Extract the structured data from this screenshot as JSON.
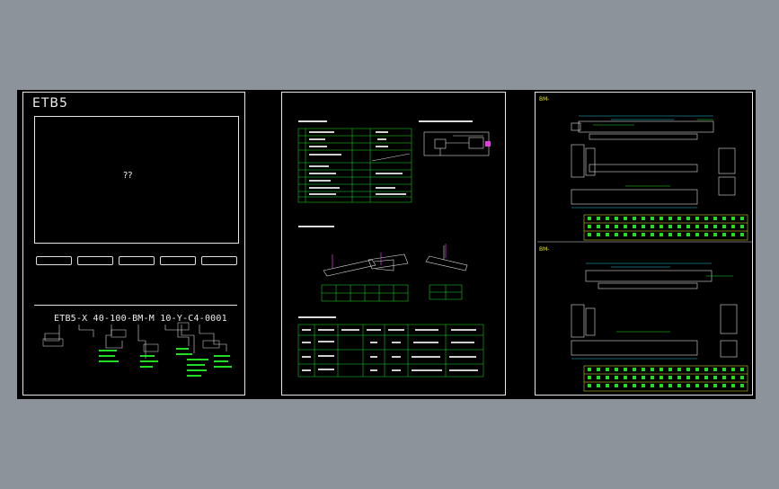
{
  "sheet1": {
    "title": "ETB5",
    "preview_text": "??",
    "buttons": [
      "",
      "",
      "",
      "",
      ""
    ],
    "model_label": "",
    "model_code": "ETB5-X 40-100-BM-M 10-Y-C4-0001"
  },
  "sheet2": {
    "section_titles": [
      "",
      "",
      "",
      ""
    ]
  },
  "sheet3": {
    "titles": [
      "BM-",
      "BM-"
    ]
  },
  "colors": {
    "background": "#8d939b",
    "canvas": "#000000",
    "frame": "#e6e6e6",
    "green": "#22dd22",
    "cyan": "#29c8d8",
    "yellow": "#e6e62a",
    "magenta": "#e040e0"
  }
}
